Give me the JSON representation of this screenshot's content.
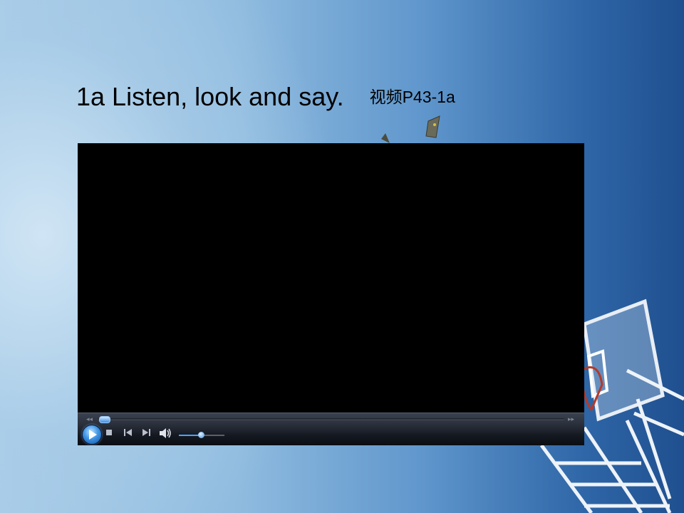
{
  "slide": {
    "title": "1a  Listen, look and say.",
    "video_tag": "视频P43-1a"
  },
  "player": {
    "seek_progress": 0.01,
    "volume_level": 0.5,
    "icons": [
      "rewind-icon",
      "fast-forward-icon",
      "play-icon",
      "stop-icon",
      "previous-icon",
      "next-icon",
      "volume-icon"
    ]
  },
  "colors": {
    "background_light": "#a9cde8",
    "background_dark": "#1f4f8f",
    "video": "#000000",
    "accent": "#3f95e6"
  }
}
